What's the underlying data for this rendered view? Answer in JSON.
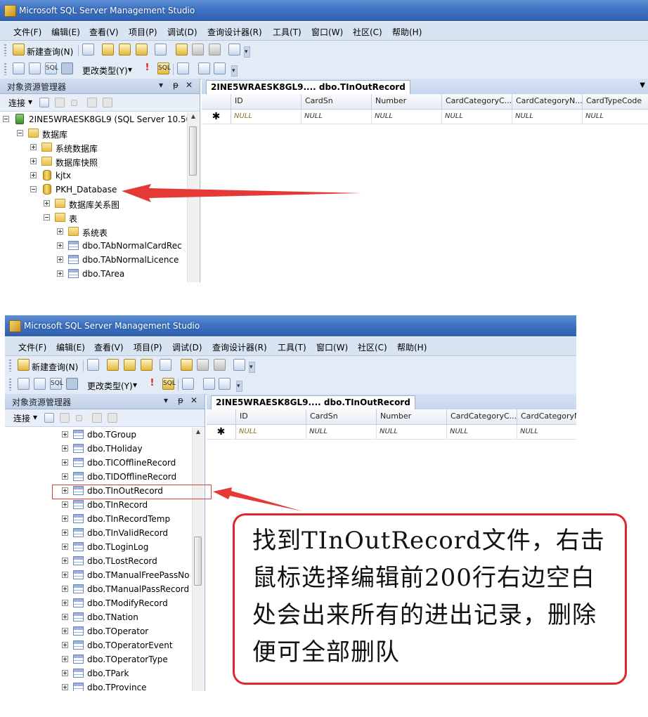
{
  "app_title": "Microsoft SQL Server Management Studio",
  "menu": [
    "文件(F)",
    "编辑(E)",
    "查看(V)",
    "项目(P)",
    "调试(D)",
    "查询设计器(R)",
    "工具(T)",
    "窗口(W)",
    "社区(C)",
    "帮助(H)"
  ],
  "toolbar": {
    "new_query": "新建查询(N)",
    "change_type": "更改类型(Y)",
    "sql_icon_text": "SQL"
  },
  "explorer": {
    "title": "对象资源管理器",
    "pin": "ᵽ",
    "close": "✕",
    "connect": "连接",
    "dropdown_arrow": "▾"
  },
  "shot1_tree": [
    {
      "label": "2INE5WRAESK8GL9 (SQL Server 10.50",
      "icon": "server-icon",
      "expander": "minus"
    },
    {
      "label": "数据库",
      "icon": "folder-icon",
      "expander": "minus"
    },
    {
      "label": "系统数据库",
      "icon": "folder-icon",
      "expander": "plus"
    },
    {
      "label": "数据库快照",
      "icon": "folder-icon",
      "expander": "plus"
    },
    {
      "label": "kjtx",
      "icon": "database-icon",
      "expander": "plus"
    },
    {
      "label": "PKH_Database",
      "icon": "database-icon",
      "expander": "minus"
    },
    {
      "label": "数据库关系图",
      "icon": "folder-icon",
      "expander": "plus"
    },
    {
      "label": "表",
      "icon": "folder-icon",
      "expander": "minus"
    },
    {
      "label": "系统表",
      "icon": "folder-icon",
      "expander": "plus"
    },
    {
      "label": "dbo.TAbNormalCardRec",
      "icon": "table-icon",
      "expander": "plus"
    },
    {
      "label": "dbo.TAbNormalLicence",
      "icon": "table-icon",
      "expander": "plus"
    },
    {
      "label": "dbo.TArea",
      "icon": "table-icon",
      "expander": "plus"
    }
  ],
  "shot2_tree": [
    "dbo.TGroup",
    "dbo.THoliday",
    "dbo.TICOfflineRecord",
    "dbo.TIDOfflineRecord",
    "dbo.TInOutRecord",
    "dbo.TInRecord",
    "dbo.TInRecordTemp",
    "dbo.TInValidRecord",
    "dbo.TLoginLog",
    "dbo.TLostRecord",
    "dbo.TManualFreePassNo",
    "dbo.TManualPassRecord",
    "dbo.TModifyRecord",
    "dbo.TNation",
    "dbo.TOperator",
    "dbo.TOperatorEvent",
    "dbo.TOperatorType",
    "dbo.TPark",
    "dbo.TProvince"
  ],
  "document": {
    "tab_title": "2INE5WRAESK8GL9.... dbo.TInOutRecord",
    "shot1_columns": [
      "ID",
      "CardSn",
      "Number",
      "CardCategoryC...",
      "CardCategoryN...",
      "CardTypeCode"
    ],
    "shot2_columns": [
      "ID",
      "CardSn",
      "Number",
      "CardCategoryC...",
      "CardCategoryN..."
    ],
    "new_row_marker": "✱",
    "null_text": "NULL"
  },
  "annotation": {
    "callout_text": "找到TInOutRecord文件，右击鼠标选择编辑前200行右边空白处会出来所有的进出记录，删除便可全部删队",
    "color": "#e0272c"
  }
}
